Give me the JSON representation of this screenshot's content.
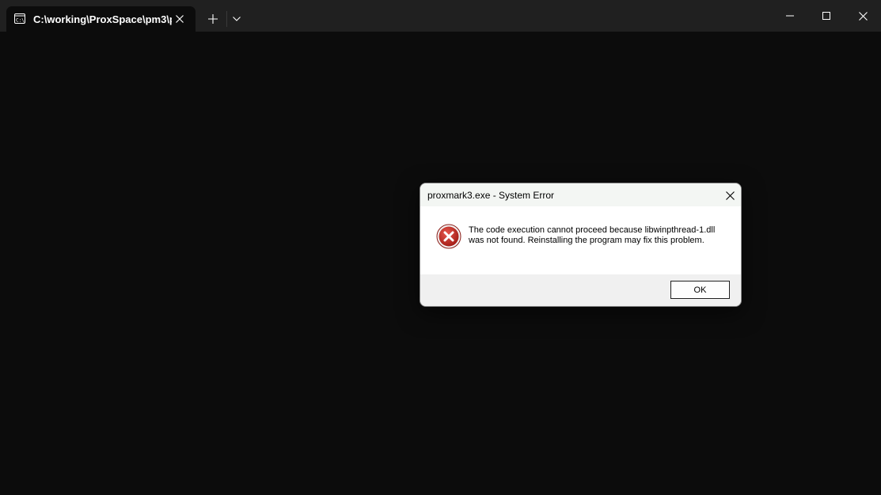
{
  "terminal": {
    "tab_title": "C:\\working\\ProxSpace\\pm3\\p",
    "background_color": "#0c0c0c",
    "titlebar_color": "#202020"
  },
  "icons": {
    "tab_icon": "terminal-icon",
    "tab_close": "close-icon",
    "new_tab": "plus-icon",
    "dropdown": "chevron-down-icon",
    "minimize": "minimize-icon",
    "maximize": "maximize-icon",
    "close": "close-icon",
    "error": "error-icon"
  },
  "dialog": {
    "title": "proxmark3.exe - System Error",
    "message": "The code execution cannot proceed because libwinpthread-1.dll was not found. Reinstalling the program may fix this problem.",
    "ok_label": "OK",
    "error_color": "#c42b1c"
  }
}
